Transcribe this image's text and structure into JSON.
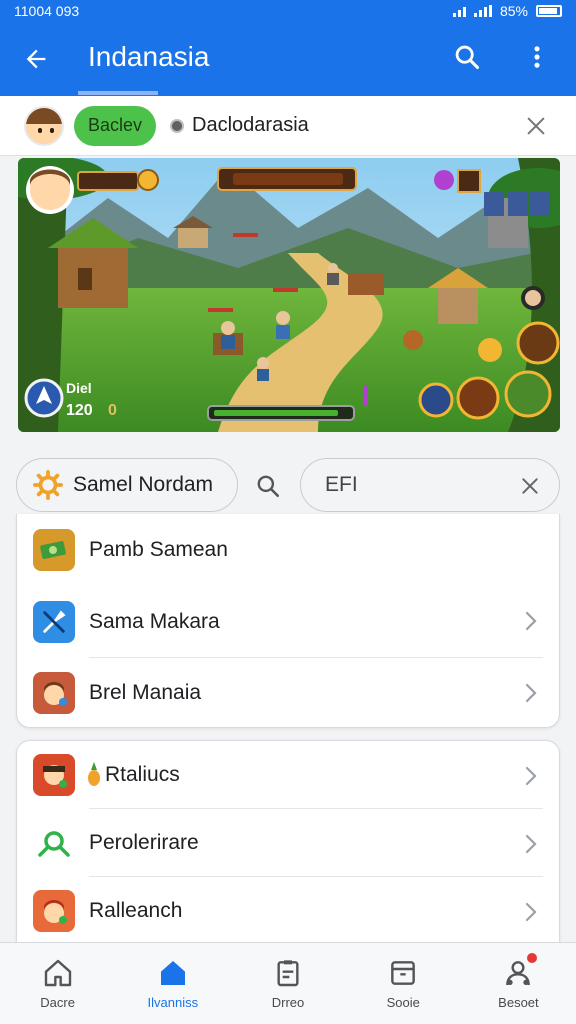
{
  "status": {
    "time": "11004 093",
    "battery": "85%"
  },
  "appbar": {
    "title": "Indanasia"
  },
  "chip": {
    "badge": "Baclev",
    "text": "Daclodarasia"
  },
  "game": {
    "panel_text": "Diel",
    "panel_number": "120",
    "panel_extra": "0"
  },
  "search": {
    "left_pill": "Samel Nordam",
    "right_pill": "EFI"
  },
  "list1": [
    {
      "label": "Pamb Samean",
      "icon": "cash-icon",
      "color": "#d79a2a"
    },
    {
      "label": "Sama Makara",
      "icon": "tools-icon",
      "color": "#2f8de4"
    },
    {
      "label": "Brel Manaia",
      "icon": "avatar-icon",
      "color": "#c75a3a"
    }
  ],
  "list2": [
    {
      "label": "Rtaliucs",
      "icon": "game-icon",
      "color": "#d84a2a"
    },
    {
      "label": "Perolerirare",
      "icon": "share-icon",
      "color": "#2fb24a"
    },
    {
      "label": "Ralleanch",
      "icon": "avatar-icon",
      "color": "#e86a3a"
    }
  ],
  "nav": [
    {
      "label": "Dacre",
      "icon": "home-icon"
    },
    {
      "label": "Ilvanniss",
      "icon": "home-icon"
    },
    {
      "label": "Drreo",
      "icon": "clipboard-icon"
    },
    {
      "label": "Sooie",
      "icon": "folder-icon"
    },
    {
      "label": "Besoet",
      "icon": "people-icon"
    }
  ],
  "colors": {
    "primary": "#1a73e8",
    "green": "#4cc24a",
    "badge": "#e53935"
  }
}
